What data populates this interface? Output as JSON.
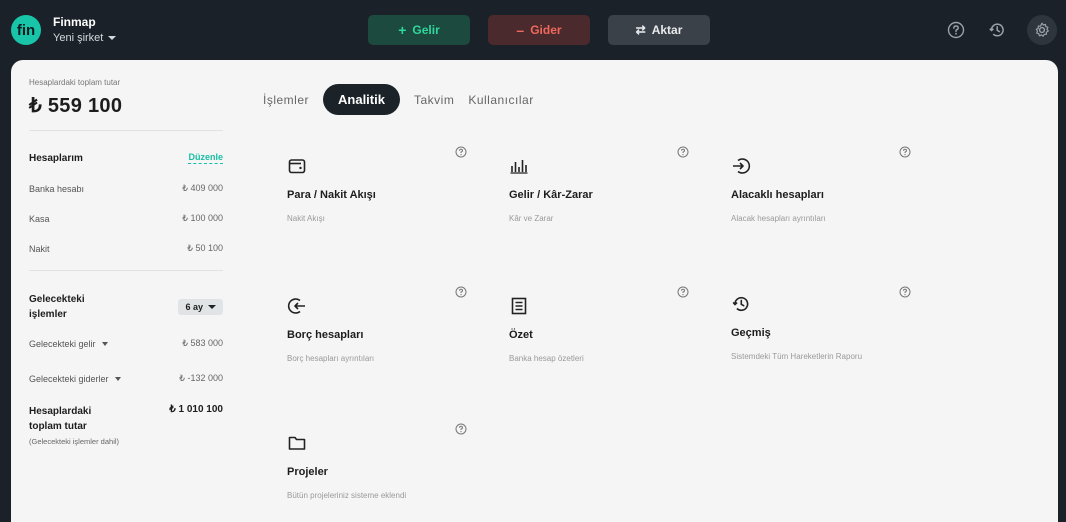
{
  "header": {
    "logo_text": "fin",
    "brand": "Finmap",
    "company": "Yeni şirket",
    "buttons": {
      "income": {
        "icon": "+",
        "label": "Gelir"
      },
      "expense": {
        "icon": "–",
        "label": "Gider"
      },
      "transfer": {
        "icon": "⇄",
        "label": "Aktar"
      }
    },
    "icons": [
      "help-icon",
      "history-icon",
      "settings-icon"
    ]
  },
  "sidebar": {
    "total_label": "Hesaplardaki toplam tutar",
    "total_value": "₺ 559 100",
    "accounts_title": "Hesaplarım",
    "edit_label": "Düzenle",
    "accounts": [
      {
        "name": "Banka hesabı",
        "amount": "₺ 409 000"
      },
      {
        "name": "Kasa",
        "amount": "₺ 100 000"
      },
      {
        "name": "Nakit",
        "amount": "₺ 50 100"
      }
    ],
    "future_title_line1": "Gelecekteki",
    "future_title_line2": "işlemler",
    "period": "6 ay",
    "future_rows": [
      {
        "name": "Gelecekteki gelir",
        "amount": "₺ 583 000"
      },
      {
        "name": "Gelecekteki giderler",
        "amount": "₺ -132 000"
      }
    ],
    "grand_title_line1": "Hesaplardaki",
    "grand_title_line2": "toplam tutar",
    "grand_value": "₺ 1 010 100",
    "grand_note": "(Gelecekteki işlemler dahil)"
  },
  "tabs": [
    "İşlemler",
    "Analitik",
    "Takvim",
    "Kullanıcılar"
  ],
  "active_tab": "Analitik",
  "tiles": [
    {
      "icon": "wallet-icon",
      "title": "Para / Nakit Akışı",
      "desc": "Nakit Akışı"
    },
    {
      "icon": "bar-chart-icon",
      "title": "Gelir / Kâr-Zarar",
      "desc": "Kâr ve Zarar"
    },
    {
      "icon": "receivable-icon",
      "title": "Alacaklı hesapları",
      "desc": "Alacak hesapları ayrıntıları"
    },
    {
      "icon": "payable-icon",
      "title": "Borç hesapları",
      "desc": "Borç hesapları ayrıntıları"
    },
    {
      "icon": "summary-icon",
      "title": "Özet",
      "desc": "Banka hesap özetleri"
    },
    {
      "icon": "history-icon",
      "title": "Geçmiş",
      "desc": "Sistemdeki Tüm Hareketlerin Raporu"
    },
    {
      "icon": "folder-icon",
      "title": "Projeler",
      "desc": "Bütün projeleriniz sisteme eklendi"
    }
  ],
  "colors": {
    "accent": "#18bfa5",
    "income": "#2fd79c",
    "expense": "#f0695e",
    "background": "#1a2129",
    "card": "#f5f5f5"
  }
}
